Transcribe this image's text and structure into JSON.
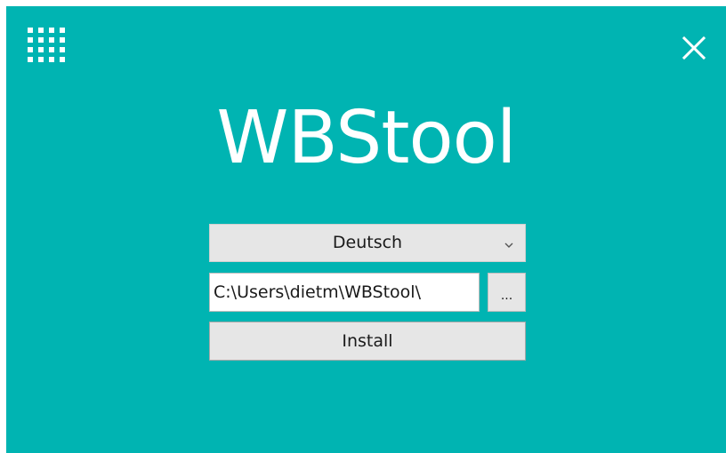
{
  "app": {
    "title": "WBStool",
    "background_color": "#00b4b2"
  },
  "header": {
    "menu_icon": "grid-menu-icon",
    "close_icon": "close-icon"
  },
  "language": {
    "selected": "Deutsch",
    "icon": "chevron-down-icon"
  },
  "install_path": {
    "value": "C:\\Users\\dietm\\WBStool\\",
    "browse_label": "..."
  },
  "actions": {
    "install_label": "Install"
  }
}
